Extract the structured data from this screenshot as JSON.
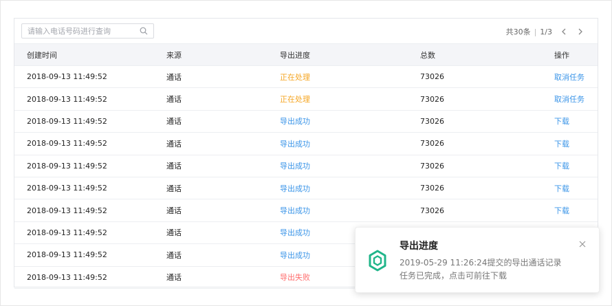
{
  "search": {
    "placeholder": "请输入电话号码进行查询"
  },
  "pager": {
    "total": "共30条",
    "page": "1/3"
  },
  "table": {
    "headers": [
      "创建时间",
      "来源",
      "导出进度",
      "总数",
      "操作"
    ],
    "rows": [
      {
        "created": "2018-09-13 11:49:52",
        "source": "通话",
        "progress": "正在处理",
        "status": "processing",
        "total": "73026",
        "action": "取消任务"
      },
      {
        "created": "2018-09-13 11:49:52",
        "source": "通话",
        "progress": "正在处理",
        "status": "processing",
        "total": "73026",
        "action": "取消任务"
      },
      {
        "created": "2018-09-13 11:49:52",
        "source": "通话",
        "progress": "导出成功",
        "status": "success",
        "total": "73026",
        "action": "下载"
      },
      {
        "created": "2018-09-13 11:49:52",
        "source": "通话",
        "progress": "导出成功",
        "status": "success",
        "total": "73026",
        "action": "下载"
      },
      {
        "created": "2018-09-13 11:49:52",
        "source": "通话",
        "progress": "导出成功",
        "status": "success",
        "total": "73026",
        "action": "下载"
      },
      {
        "created": "2018-09-13 11:49:52",
        "source": "通话",
        "progress": "导出成功",
        "status": "success",
        "total": "73026",
        "action": "下载"
      },
      {
        "created": "2018-09-13 11:49:52",
        "source": "通话",
        "progress": "导出成功",
        "status": "success",
        "total": "73026",
        "action": "下载"
      },
      {
        "created": "2018-09-13 11:49:52",
        "source": "通话",
        "progress": "导出成功",
        "status": "success",
        "total": "",
        "action": ""
      },
      {
        "created": "2018-09-13 11:49:52",
        "source": "通话",
        "progress": "导出成功",
        "status": "success",
        "total": "",
        "action": ""
      },
      {
        "created": "2018-09-13 11:49:52",
        "source": "通话",
        "progress": "导出失败",
        "status": "fail",
        "total": "",
        "action": ""
      }
    ]
  },
  "toast": {
    "title": "导出进度",
    "line1": "2019-05-29 11:26:24提交的导出通话记录",
    "line2": "任务已完成，点击可前往下载",
    "icon": "hexagon-logo-icon"
  },
  "colors": {
    "processing": "#f5a623",
    "success": "#3b95e8",
    "fail": "#ff6d6d",
    "brand": "#20b58a"
  }
}
